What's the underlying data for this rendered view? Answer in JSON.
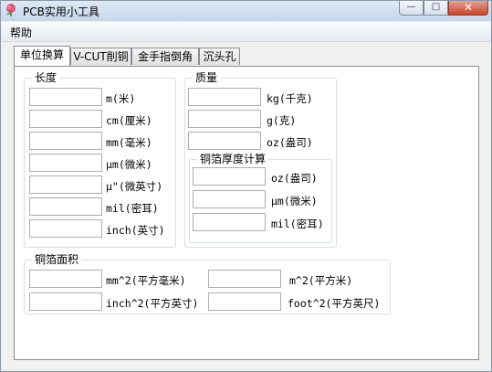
{
  "window": {
    "title": "PCB实用小工具"
  },
  "title_buttons": {
    "minimize": "—",
    "maximize": "□",
    "close": "✕"
  },
  "menu": {
    "help": "帮助"
  },
  "tabs": [
    {
      "label": "单位换算"
    },
    {
      "label": "V-CUT削铜"
    },
    {
      "label": "金手指倒角"
    },
    {
      "label": "沉头孔"
    }
  ],
  "length": {
    "title": "长度",
    "units": [
      "m(米)",
      "cm(厘米)",
      "mm(毫米)",
      "μm(微米)",
      "μ\"(微英寸)",
      "mil(密耳)",
      "inch(英寸)"
    ],
    "values": [
      "",
      "",
      "",
      "",
      "",
      "",
      ""
    ]
  },
  "mass": {
    "title": "质量",
    "units": [
      "kg(千克)",
      "g(克)",
      "oz(盎司)"
    ],
    "values": [
      "",
      "",
      ""
    ]
  },
  "copper_thickness": {
    "title": "铜箔厚度计算",
    "units": [
      "oz(盎司)",
      "μm(微米)",
      "mil(密耳)"
    ],
    "values": [
      "",
      "",
      ""
    ]
  },
  "copper_area": {
    "title": "铜箔面积",
    "units": [
      "mm^2(平方毫米)",
      "m^2(平方米)",
      "inch^2(平方英寸)",
      "foot^2(平方英尺)"
    ],
    "values": [
      "",
      "",
      "",
      ""
    ]
  }
}
